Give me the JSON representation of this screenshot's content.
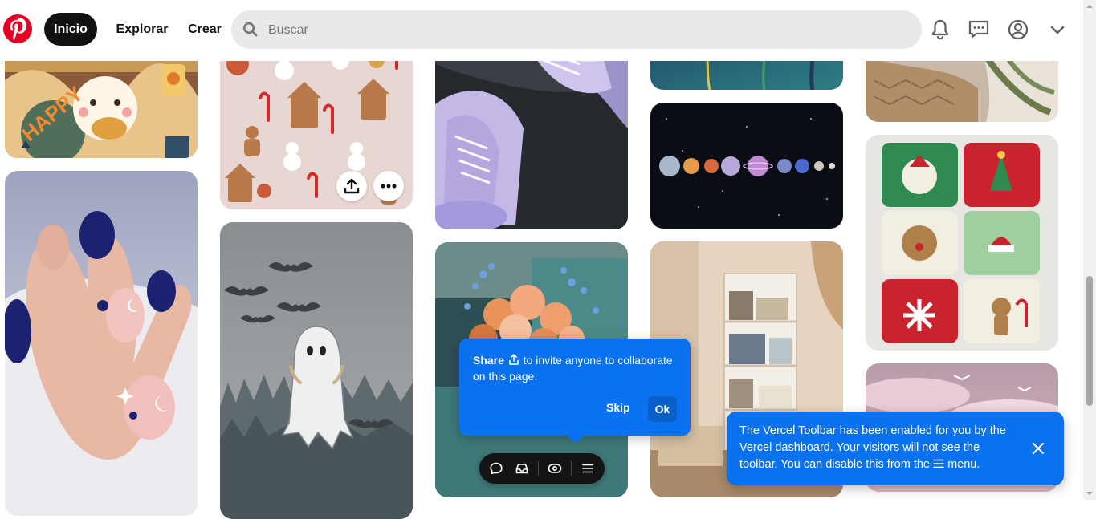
{
  "header": {
    "logo_name": "pinterest-logo",
    "nav": {
      "home": "Inicio",
      "explore": "Explorar",
      "create": "Crear"
    },
    "search": {
      "placeholder": "Buscar",
      "value": ""
    },
    "icons": [
      "bell-icon",
      "messages-icon",
      "profile-icon",
      "chevron-down-icon"
    ]
  },
  "colors": {
    "brand": "#e60023",
    "nav_active_bg": "#111111",
    "search_bg": "#e9e9e9",
    "vercel_blue": "#0a72ef",
    "toolbar_bg": "#141414"
  },
  "pins": [
    {
      "id": "pin-kawaii-bear",
      "subject": "kawaii bear stickers",
      "column": 1
    },
    {
      "id": "pin-nails",
      "subject": "navy and pink nails",
      "column": 1
    },
    {
      "id": "pin-gingerbread",
      "subject": "christmas gingerbread pattern",
      "column": 2
    },
    {
      "id": "pin-ghost",
      "subject": "ghost in foggy forest",
      "column": 2
    },
    {
      "id": "pin-converse",
      "subject": "lavender converse shoes",
      "column": 3
    },
    {
      "id": "pin-flowers",
      "subject": "flower bouquet",
      "column": 3
    },
    {
      "id": "pin-teal",
      "subject": "teal abstract",
      "column": 4
    },
    {
      "id": "pin-planets",
      "subject": "planets in space",
      "column": 4
    },
    {
      "id": "pin-bookshelf",
      "subject": "room with bookshelf",
      "column": 4
    },
    {
      "id": "pin-blanket",
      "subject": "knitted blanket",
      "column": 5
    },
    {
      "id": "pin-crochet",
      "subject": "crochet christmas bags",
      "column": 5
    },
    {
      "id": "pin-sky",
      "subject": "pink sky",
      "column": 5
    }
  ],
  "pin_actions": [
    "share-icon",
    "more-options-icon"
  ],
  "share_popover": {
    "bold": "Share",
    "text": "to invite anyone to collaborate on this page.",
    "skip_label": "Skip",
    "ok_label": "Ok"
  },
  "vercel_toolbar": {
    "icons": [
      "comment-icon",
      "inbox-icon",
      "preview-eye-icon",
      "menu-icon"
    ]
  },
  "vercel_toast": {
    "text_before": "The Vercel Toolbar has been enabled for you by the Vercel dashboard. Your visitors will not see the toolbar. You can disable this from the",
    "text_after": "menu."
  }
}
